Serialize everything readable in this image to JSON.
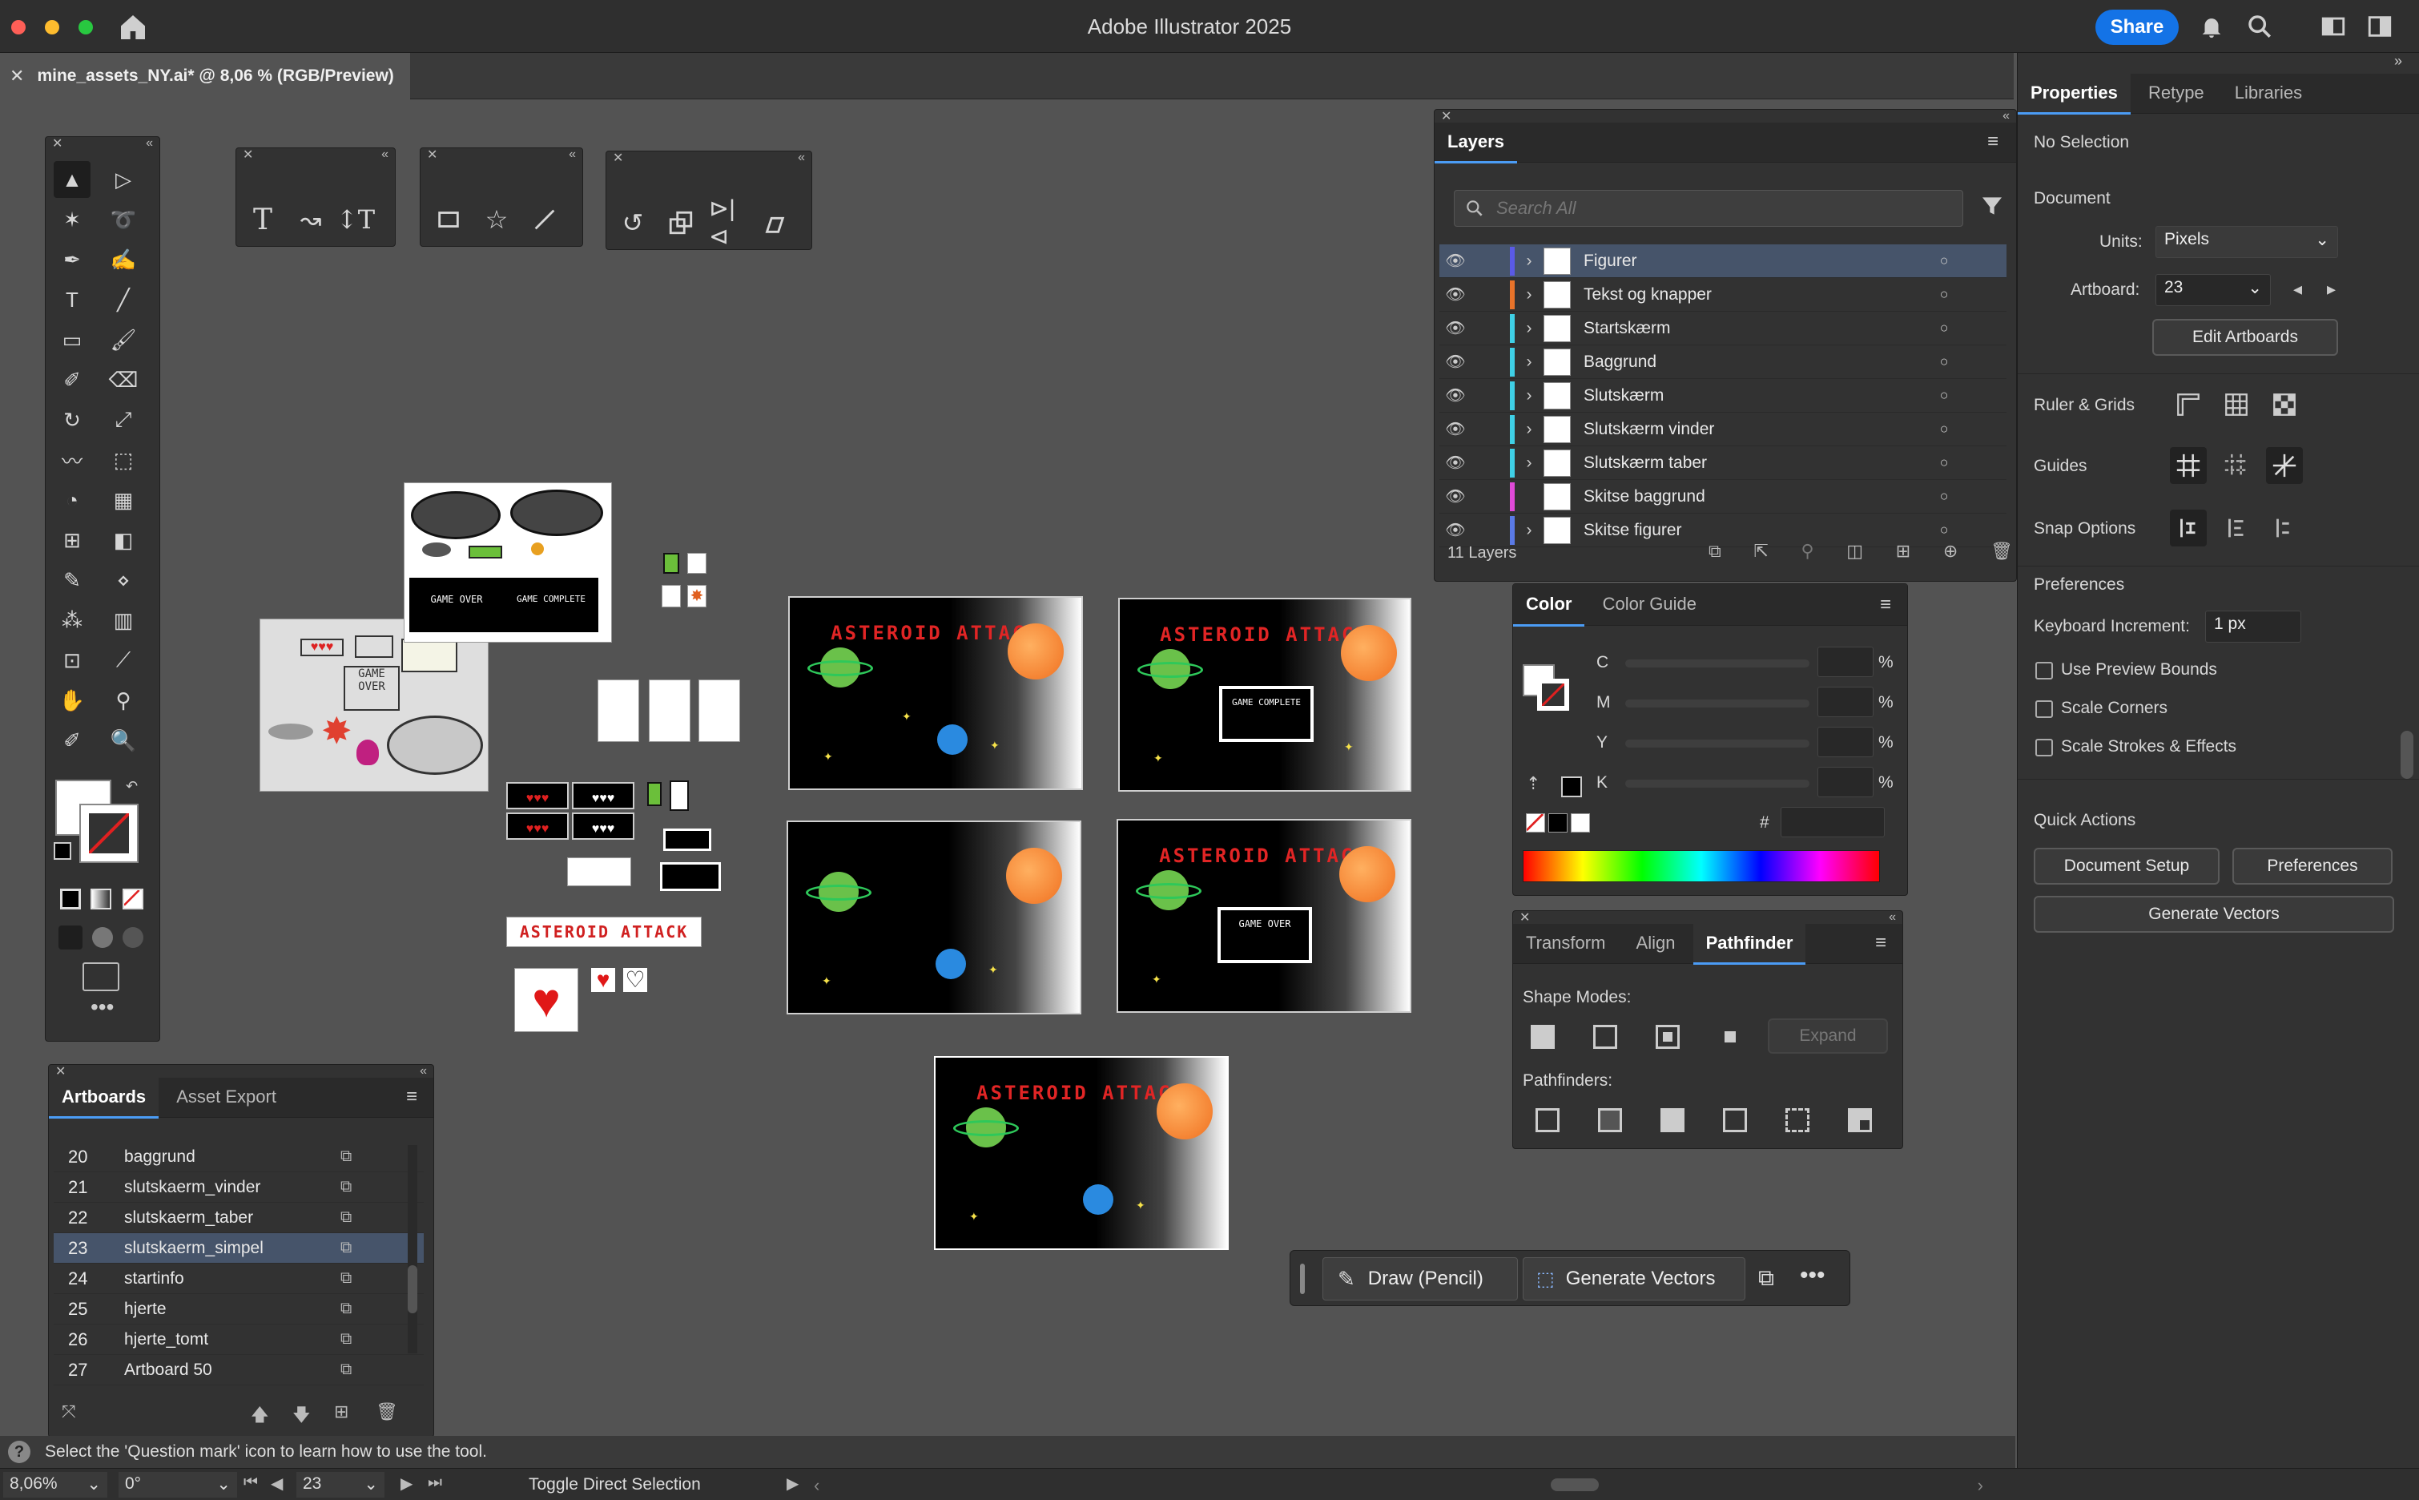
{
  "titlebar": {
    "title": "Adobe Illustrator 2025",
    "share_label": "Share"
  },
  "document_tab": {
    "label": "mine_assets_NY.ai* @ 8,06 % (RGB/Preview)"
  },
  "layers": {
    "title": "Layers",
    "search_placeholder": "Search All",
    "items": [
      {
        "name": "Figurer",
        "color": "#5a5ae6"
      },
      {
        "name": "Tekst og knapper",
        "color": "#e8732a"
      },
      {
        "name": "Startskærm",
        "color": "#3fd0e6"
      },
      {
        "name": "Baggrund",
        "color": "#3fd0e6"
      },
      {
        "name": "Slutskærm",
        "color": "#3fd0e6"
      },
      {
        "name": "Slutskærm vinder",
        "color": "#3fd0e6"
      },
      {
        "name": "Slutskærm taber",
        "color": "#3fd0e6"
      },
      {
        "name": "Skitse baggrund",
        "color": "#e04ad8"
      },
      {
        "name": "Skitse figurer",
        "color": "#5a7ae6"
      }
    ],
    "count": "11 Layers"
  },
  "properties": {
    "tabs": [
      "Properties",
      "Retype",
      "Libraries"
    ],
    "no_selection": "No Selection",
    "document_label": "Document",
    "units_label": "Units:",
    "units_value": "Pixels",
    "artboard_label": "Artboard:",
    "artboard_value": "23",
    "edit_artboards": "Edit Artboards",
    "ruler_grids": "Ruler & Grids",
    "guides": "Guides",
    "snap_options": "Snap Options",
    "preferences_heading": "Preferences",
    "keyboard_increment_label": "Keyboard Increment:",
    "keyboard_increment_value": "1 px",
    "use_preview_bounds": "Use Preview Bounds",
    "scale_corners": "Scale Corners",
    "scale_strokes": "Scale Strokes & Effects",
    "quick_actions": "Quick Actions",
    "document_setup": "Document Setup",
    "preferences_button": "Preferences",
    "generate_vectors": "Generate Vectors"
  },
  "color_panel": {
    "tabs": [
      "Color",
      "Color Guide"
    ],
    "channels": [
      "C",
      "M",
      "Y",
      "K"
    ],
    "percent": "%",
    "hash": "#"
  },
  "pathfinder_panel": {
    "tabs": [
      "Transform",
      "Align",
      "Pathfinder"
    ],
    "shape_modes": "Shape Modes:",
    "expand": "Expand",
    "pathfinders": "Pathfinders:"
  },
  "artboards_panel": {
    "tabs": [
      "Artboards",
      "Asset Export"
    ],
    "rows": [
      {
        "num": "20",
        "name": "baggrund"
      },
      {
        "num": "21",
        "name": "slutskaerm_vinder"
      },
      {
        "num": "22",
        "name": "slutskaerm_taber"
      },
      {
        "num": "23",
        "name": "slutskaerm_simpel"
      },
      {
        "num": "24",
        "name": "startinfo"
      },
      {
        "num": "25",
        "name": "hjerte"
      },
      {
        "num": "26",
        "name": "hjerte_tomt"
      },
      {
        "num": "27",
        "name": "Artboard 50"
      }
    ]
  },
  "canvas": {
    "game_title": "ASTEROID ATTACK",
    "game_complete": "GAME COMPLETE",
    "game_over": "GAME OVER",
    "sketch_game_over": "GAME OVER",
    "sketch_game_complete": "GAME COMPLETE",
    "banner": "ASTEROID ATTACK"
  },
  "context_bar": {
    "draw_label": "Draw (Pencil)",
    "generate_label": "Generate Vectors"
  },
  "status": {
    "hint": "Select the 'Question mark' icon to learn how to use the tool.",
    "zoom": "8,06%",
    "rotation": "0°",
    "artboard": "23",
    "tool": "Toggle Direct Selection"
  }
}
